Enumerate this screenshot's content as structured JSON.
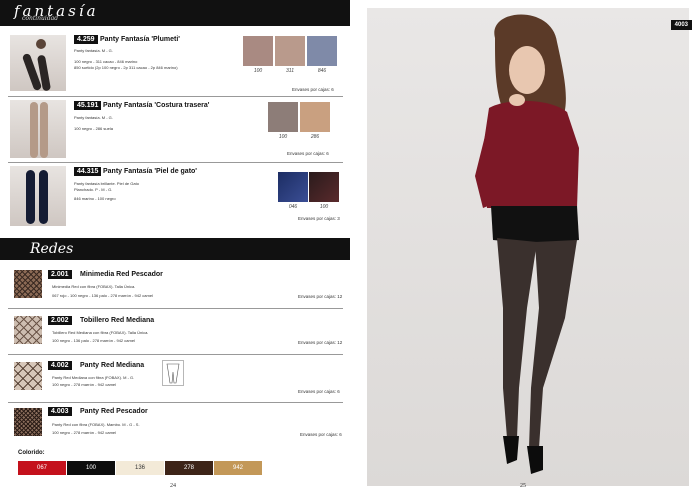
{
  "header": {
    "script_title": "fantasía",
    "subtitle": "continuidad"
  },
  "products_top": [
    {
      "code": "4.259",
      "name": "Panty Fantasía 'Plumeti'",
      "desc": [
        "Panty fantasía. M - G.",
        "100 negro - 311 cacao - 846 marino",
        "850 surtido (2p 100 negro - 2p 311 cacao - 2p 846 marino)"
      ],
      "swatches": [
        {
          "label": "100",
          "color": "#a98a82"
        },
        {
          "label": "311",
          "color": "#b99a8c"
        },
        {
          "label": "846",
          "color": "#7f8aa8"
        }
      ],
      "box": "Envases por cajas: 6"
    },
    {
      "code": "45.191",
      "name": "Panty Fantasía 'Costura trasera'",
      "desc": [
        "Panty fantasía. M - G.",
        "100 negro - 286 suela"
      ],
      "swatches": [
        {
          "label": "100",
          "color": "#8d7d78"
        },
        {
          "label": "286",
          "color": "#c9a080"
        }
      ],
      "box": "Envases por cajas: 6"
    },
    {
      "code": "44.315",
      "name": "Panty Fantasía 'Piel de gato'",
      "desc": [
        "Panty fantasía brillante. Piel de Gato",
        "Planchado. P - M - G.",
        "846 marino - 100 negro"
      ],
      "swatches": [
        {
          "label": "046",
          "color": "#1c2d63"
        },
        {
          "label": "100",
          "color": "#2a1b1c"
        }
      ],
      "box": "Envases por cajas: 3"
    }
  ],
  "redes": {
    "title": "Redes"
  },
  "products_redes": [
    {
      "code": "2.001",
      "name": "Minimedia Red Pescador",
      "desc": [
        "Minimedia Red con fibra (FOBAX). Talla Única.",
        "067 rojo - 100 negro - 136 palo - 278 marrón - 942 camel"
      ],
      "box": "Envases por cajas: 12"
    },
    {
      "code": "2.002",
      "name": "Tobillero Red Mediana",
      "desc": [
        "Tobillero Red Mediana con fibra (FOBAX). Talla Única.",
        "100 negro - 136 palo - 278 marrón - 942 camel"
      ],
      "box": "Envases por cajas: 12"
    },
    {
      "code": "4.002",
      "name": "Panty Red Mediana",
      "desc": [
        "Panty Red Mediana con fibra (FOBAX). M - G.",
        "100 negro - 278 marrón - 942 camel"
      ],
      "box": "Envases por cajas: 6"
    },
    {
      "code": "4.003",
      "name": "Panty Red Pescador",
      "desc": [
        "Panty Red con fibra (FOBAX). Mambo. M - G - S.",
        "100 negro - 278 marrón - 942 camel"
      ],
      "box": "Envases por cajas: 6"
    }
  ],
  "colorido": {
    "label": "Colorido:",
    "colors": [
      {
        "code": "067",
        "bg": "#c4111c",
        "fg": "#ffffff"
      },
      {
        "code": "100",
        "bg": "#0d0d0d",
        "fg": "#ffffff"
      },
      {
        "code": "136",
        "bg": "#f3ead8",
        "fg": "#333333"
      },
      {
        "code": "278",
        "bg": "#3d2418",
        "fg": "#ffffff"
      },
      {
        "code": "942",
        "bg": "#c39858",
        "fg": "#ffffff"
      }
    ]
  },
  "page_left": "24",
  "page_right": "25",
  "right_tag": "4003"
}
